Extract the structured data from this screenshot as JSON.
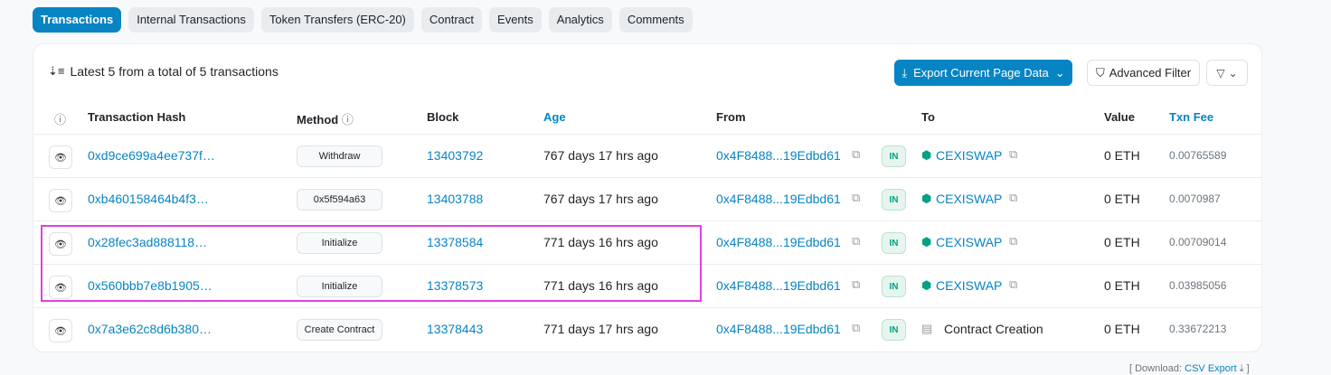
{
  "tabs": [
    {
      "label": "Transactions",
      "active": true
    },
    {
      "label": "Internal Transactions"
    },
    {
      "label": "Token Transfers (ERC-20)"
    },
    {
      "label": "Contract"
    },
    {
      "label": "Events"
    },
    {
      "label": "Analytics"
    },
    {
      "label": "Comments"
    }
  ],
  "summary": "Latest 5 from a total of 5 transactions",
  "toolbar": {
    "export_label": "Export Current Page Data",
    "advanced_filter_label": "Advanced Filter"
  },
  "columns": {
    "hash": "Transaction Hash",
    "method": "Method",
    "block": "Block",
    "age": "Age",
    "from": "From",
    "to": "To",
    "value": "Value",
    "fee": "Txn Fee"
  },
  "rows": [
    {
      "hash": "0xd9ce699a4ee737f…",
      "method": "Withdraw",
      "block": "13403792",
      "age": "767 days 17 hrs ago",
      "from": "0x4F8488...19Edbd61",
      "direction": "IN",
      "to": "CEXISWAP",
      "value": "0 ETH",
      "fee": "0.00765589"
    },
    {
      "hash": "0xb460158464b4f3…",
      "method": "0x5f594a63",
      "block": "13403788",
      "age": "767 days 17 hrs ago",
      "from": "0x4F8488...19Edbd61",
      "direction": "IN",
      "to": "CEXISWAP",
      "value": "0 ETH",
      "fee": "0.0070987"
    },
    {
      "hash": "0x28fec3ad888118…",
      "method": "Initialize",
      "block": "13378584",
      "age": "771 days 16 hrs ago",
      "from": "0x4F8488...19Edbd61",
      "direction": "IN",
      "to": "CEXISWAP",
      "value": "0 ETH",
      "fee": "0.00709014"
    },
    {
      "hash": "0x560bbb7e8b1905…",
      "method": "Initialize",
      "block": "13378573",
      "age": "771 days 16 hrs ago",
      "from": "0x4F8488...19Edbd61",
      "direction": "IN",
      "to": "CEXISWAP",
      "value": "0 ETH",
      "fee": "0.03985056"
    },
    {
      "hash": "0x7a3e62c8d6b380…",
      "method": "Create Contract",
      "block": "13378443",
      "age": "771 days 17 hrs ago",
      "from": "0x4F8488...19Edbd61",
      "direction": "IN",
      "to": "Contract Creation",
      "value": "0 ETH",
      "fee": "0.33672213"
    }
  ],
  "footer": {
    "prefix": "[ Download:",
    "csv_label": "CSV Export",
    "suffix": "]"
  },
  "colors": {
    "accent": "#0784c3",
    "highlight": "#e040e0",
    "in_badge": "#00a186"
  }
}
